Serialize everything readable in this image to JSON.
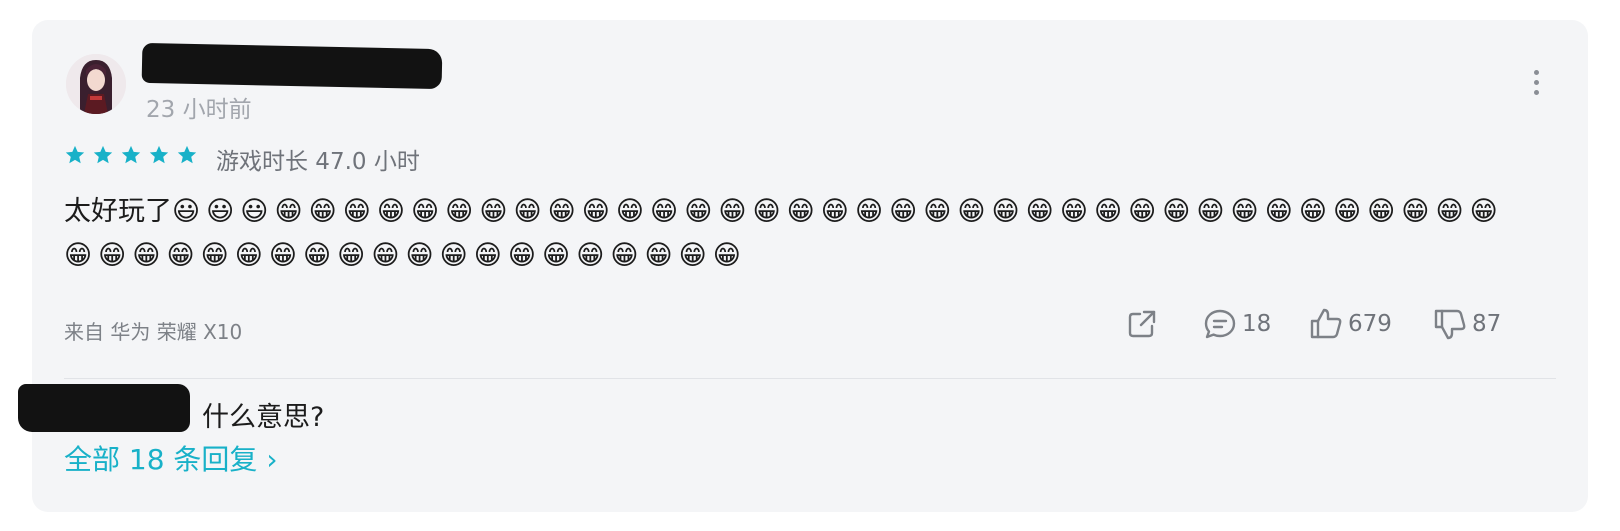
{
  "comment": {
    "time_ago": "23 小时前",
    "rating_stars": 5,
    "playtime_label": "游戏时长 47.0 小时",
    "text": "太好玩了",
    "emojis": "😃😃😃😁😁😁😁😁😁😁😁😁😁😁😁😁😁😁😁😁😁😁😁😁😁😁😁😁😁😁😁😁😁😁😁😁😁😁😁😁😁😁😁😁😁😁😁😁😁😁😁😁😁😁😁😁😁😁😁",
    "device": "来自 华为 荣耀 X10",
    "actions": {
      "comments_count": "18",
      "likes_count": "679",
      "dislikes_count": "87"
    }
  },
  "reply_preview": {
    "text": "什么意思?",
    "all_replies_link": "全部 18 条回复 ›"
  },
  "colors": {
    "accent": "#18b1c8",
    "card_bg": "#f4f5f7",
    "muted": "#a2a6ad"
  },
  "icons": [
    "more-vertical-icon",
    "star-icon",
    "share-icon",
    "comment-icon",
    "thumbs-up-icon",
    "thumbs-down-icon"
  ]
}
